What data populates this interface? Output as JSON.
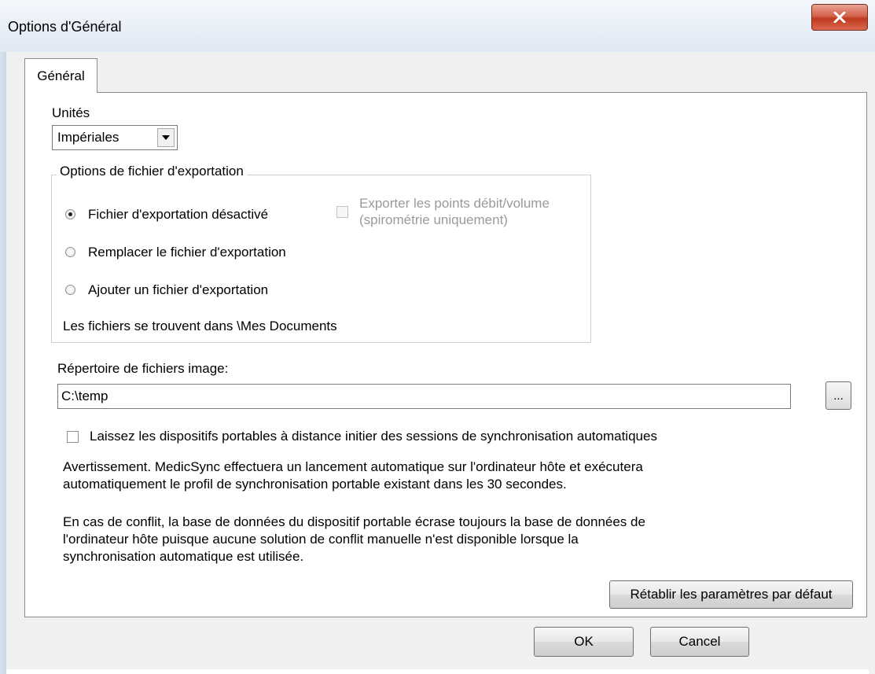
{
  "window": {
    "title": "Options d'Général"
  },
  "tabs": [
    {
      "label": "Général",
      "active": true
    }
  ],
  "units": {
    "label": "Unités",
    "selected": "Impériales"
  },
  "export_group": {
    "title": "Options de fichier d'exportation",
    "options": [
      {
        "label": "Fichier d'exportation désactivé",
        "selected": true
      },
      {
        "label": "Remplacer le fichier d'exportation",
        "selected": false
      },
      {
        "label": "Ajouter un fichier d'exportation",
        "selected": false
      }
    ],
    "flow_volume_checkbox": {
      "line1": "Exporter les points débit/volume",
      "line2": "(spirométrie uniquement)",
      "checked": false,
      "disabled": true
    },
    "location_note": "Les fichiers se trouvent dans \\Mes Documents"
  },
  "image_dir": {
    "label": "Répertoire de fichiers image:",
    "value": "C:\\temp",
    "browse_label": "..."
  },
  "auto_sync": {
    "label": "Laissez les dispositifs portables à distance initier des sessions de synchronisation automatiques",
    "checked": false,
    "warning_line1": "Avertissement.  MedicSync effectuera un lancement automatique sur l'ordinateur hôte et exécutera",
    "warning_line2": "automatiquement le profil de synchronisation portable existant dans les 30 secondes.",
    "conflict_line1": "En cas de conflit, la base de données du dispositif portable écrase toujours la base de données de",
    "conflict_line2": "l'ordinateur hôte puisque aucune solution de conflit manuelle n'est disponible lorsque la",
    "conflict_line3": "synchronisation automatique est utilisée."
  },
  "buttons": {
    "reset": "Rétablir les paramètres par défaut",
    "ok": "OK",
    "cancel": "Cancel"
  },
  "colors": {
    "close_button": "#c9452b",
    "panel": "#ffffff",
    "window": "#f0f0f0"
  }
}
